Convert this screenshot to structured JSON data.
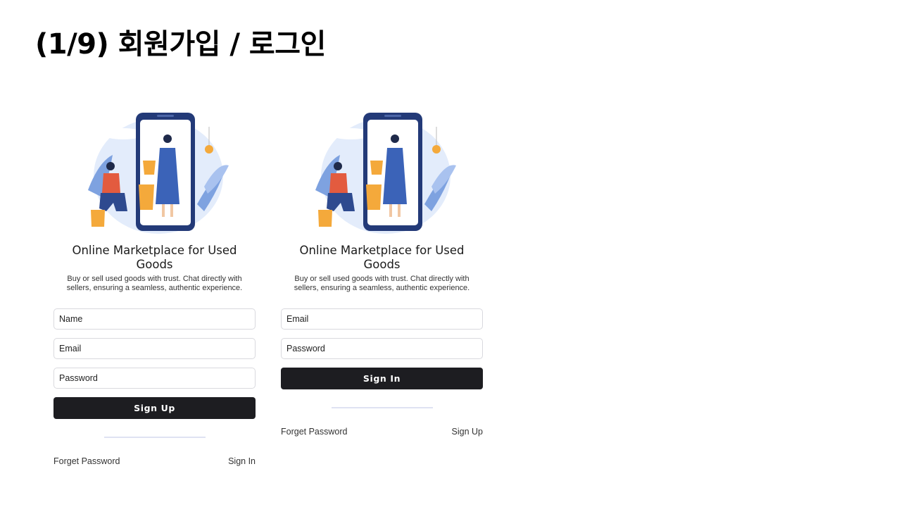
{
  "slide": {
    "title": "(1/9) 회원가입 / 로그인"
  },
  "signup": {
    "heading": "Online Marketplace for Used Goods",
    "description": "Buy or sell used goods with trust. Chat directly with sellers, ensuring a seamless, authentic experience.",
    "name_placeholder": "Name",
    "email_placeholder": "Email",
    "password_placeholder": "Password",
    "submit_label": "Sign Up",
    "forgot_label": "Forget Password",
    "alt_label": "Sign In"
  },
  "signin": {
    "heading": "Online Marketplace for Used Goods",
    "description": "Buy or sell used goods with trust. Chat directly with sellers, ensuring a seamless, authentic experience.",
    "email_placeholder": "Email",
    "password_placeholder": "Password",
    "submit_label": "Sign In",
    "forgot_label": "Forget Password",
    "alt_label": "Sign Up"
  },
  "colors": {
    "button": "#1d1d21",
    "accent_blue": "#2f56a8",
    "accent_orange": "#f4a93b",
    "divider": "#dfe2f2"
  }
}
